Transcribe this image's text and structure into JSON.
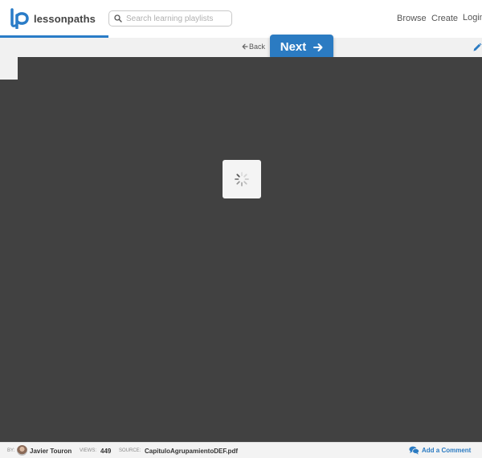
{
  "header": {
    "logo_text": "lessonpaths",
    "search_placeholder": "Search learning playlists",
    "nav": {
      "browse": "Browse",
      "create": "Create",
      "login": "Login"
    }
  },
  "toolbar": {
    "back_label": "Back",
    "next_label": "Next"
  },
  "footer": {
    "by_label": "BY:",
    "author": "Javier Touron",
    "views_label": "VIEWS:",
    "views": "449",
    "source_label": "SOURCE:",
    "source": "CapituloAgrupamientoDEF.pdf",
    "comment_label": "Add a Comment"
  },
  "colors": {
    "accent": "#2b7bc2",
    "viewer_bg": "#414141"
  },
  "icons": [
    "logo-lp-icon",
    "search-icon",
    "arrow-left-icon",
    "arrow-right-icon",
    "pencil-icon",
    "spinner-icon",
    "comment-bubbles-icon"
  ]
}
